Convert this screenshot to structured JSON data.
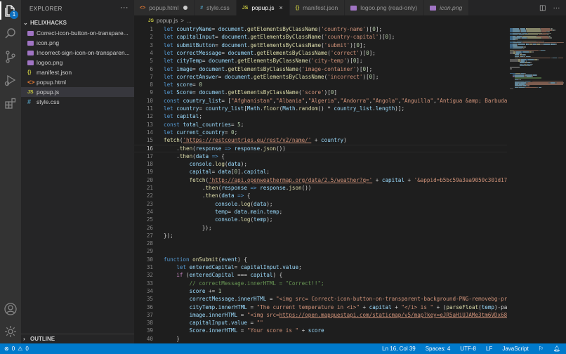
{
  "sidebar": {
    "title": "EXPLORER",
    "folder": "HELIXHACKS",
    "files": [
      {
        "name": "Correct-icon-button-on-transpare...",
        "kind": "image"
      },
      {
        "name": "icon.png",
        "kind": "image"
      },
      {
        "name": "Incorrect-sign-icon-on-transparen...",
        "kind": "image"
      },
      {
        "name": "logoo.png",
        "kind": "image"
      },
      {
        "name": "manifest.json",
        "kind": "json",
        "icon": "{}"
      },
      {
        "name": "popup.html",
        "kind": "html",
        "icon": "<>"
      },
      {
        "name": "popup.js",
        "kind": "js",
        "icon": "JS"
      },
      {
        "name": "style.css",
        "kind": "css",
        "icon": "#"
      }
    ],
    "outline": "OUTLINE"
  },
  "tabs": [
    {
      "label": "popup.html",
      "icon": "<>",
      "state": "modified"
    },
    {
      "label": "style.css",
      "icon": "#",
      "state": "normal"
    },
    {
      "label": "popup.js",
      "icon": "JS",
      "state": "active"
    },
    {
      "label": "manifest.json",
      "icon": "{}",
      "state": "normal"
    },
    {
      "label": "logoo.png (read-only)",
      "icon": "img",
      "state": "normal"
    },
    {
      "label": "icon.png",
      "icon": "img",
      "state": "italic"
    }
  ],
  "breadcrumb": {
    "file_icon": "JS",
    "file": "popup.js",
    "sep": ">",
    "rest": "..."
  },
  "editor": {
    "current_line": 16,
    "lines": [
      [
        [
          "kw",
          "let "
        ],
        [
          "var",
          "countryName"
        ],
        [
          "",
          "= "
        ],
        [
          "var",
          "document"
        ],
        [
          "",
          "."
        ],
        [
          "fn",
          "getElementsByClassName"
        ],
        [
          "",
          "("
        ],
        [
          "str",
          "'country-name'"
        ],
        [
          "",
          ")["
        ],
        [
          "num",
          "0"
        ],
        [
          "",
          "];"
        ]
      ],
      [
        [
          "kw",
          "let "
        ],
        [
          "var",
          "capitalInput"
        ],
        [
          "",
          "= "
        ],
        [
          "var",
          "document"
        ],
        [
          "",
          "."
        ],
        [
          "fn",
          "getElementsByClassName"
        ],
        [
          "",
          "("
        ],
        [
          "str",
          "'country-capital'"
        ],
        [
          "",
          ")["
        ],
        [
          "num",
          "0"
        ],
        [
          "",
          "];"
        ]
      ],
      [
        [
          "kw",
          "let "
        ],
        [
          "var",
          "submitButton"
        ],
        [
          "",
          "= "
        ],
        [
          "var",
          "document"
        ],
        [
          "",
          "."
        ],
        [
          "fn",
          "getElementsByClassName"
        ],
        [
          "",
          "("
        ],
        [
          "str",
          "'submit'"
        ],
        [
          "",
          ")["
        ],
        [
          "num",
          "0"
        ],
        [
          "",
          "];"
        ]
      ],
      [
        [
          "kw",
          "let "
        ],
        [
          "var",
          "correctMessage"
        ],
        [
          "",
          "= "
        ],
        [
          "var",
          "document"
        ],
        [
          "",
          "."
        ],
        [
          "fn",
          "getElementsByClassName"
        ],
        [
          "",
          "("
        ],
        [
          "str",
          "'correct'"
        ],
        [
          "",
          ")["
        ],
        [
          "num",
          "0"
        ],
        [
          "",
          "];"
        ]
      ],
      [
        [
          "kw",
          "let "
        ],
        [
          "var",
          "cityTemp"
        ],
        [
          "",
          "= "
        ],
        [
          "var",
          "document"
        ],
        [
          "",
          "."
        ],
        [
          "fn",
          "getElementsByClassName"
        ],
        [
          "",
          "("
        ],
        [
          "str",
          "'city-temp'"
        ],
        [
          "",
          ")["
        ],
        [
          "num",
          "0"
        ],
        [
          "",
          "];"
        ]
      ],
      [
        [
          "kw",
          "let "
        ],
        [
          "var",
          "image"
        ],
        [
          "",
          "= "
        ],
        [
          "var",
          "document"
        ],
        [
          "",
          "."
        ],
        [
          "fn",
          "getElementsByClassName"
        ],
        [
          "",
          "("
        ],
        [
          "str",
          "'image-container'"
        ],
        [
          "",
          ")["
        ],
        [
          "num",
          "0"
        ],
        [
          "",
          "];"
        ]
      ],
      [
        [
          "kw",
          "let "
        ],
        [
          "var",
          "correctAnswer"
        ],
        [
          "",
          "= "
        ],
        [
          "var",
          "document"
        ],
        [
          "",
          "."
        ],
        [
          "fn",
          "getElementsByClassName"
        ],
        [
          "",
          "("
        ],
        [
          "str",
          "'incorrect'"
        ],
        [
          "",
          ")["
        ],
        [
          "num",
          "0"
        ],
        [
          "",
          "];"
        ]
      ],
      [
        [
          "kw",
          "let "
        ],
        [
          "var",
          "score"
        ],
        [
          "",
          "= "
        ],
        [
          "num",
          "0"
        ]
      ],
      [
        [
          "kw",
          "let "
        ],
        [
          "var",
          "Score"
        ],
        [
          "",
          "= "
        ],
        [
          "var",
          "document"
        ],
        [
          "",
          "."
        ],
        [
          "fn",
          "getElementsByClassName"
        ],
        [
          "",
          "("
        ],
        [
          "str",
          "'score'"
        ],
        [
          "",
          ")["
        ],
        [
          "num",
          "0"
        ],
        [
          "",
          "]"
        ]
      ],
      [
        [
          "kw",
          "const "
        ],
        [
          "var",
          "country_list"
        ],
        [
          "",
          "= ["
        ],
        [
          "str",
          "\"Afghanistan\""
        ],
        [
          "",
          ","
        ],
        [
          "str",
          "\"Albania\""
        ],
        [
          "",
          ","
        ],
        [
          "str",
          "\"Algeria\""
        ],
        [
          "",
          ","
        ],
        [
          "str",
          "\"Andorra\""
        ],
        [
          "",
          ","
        ],
        [
          "str",
          "\"Angola\""
        ],
        [
          "",
          ","
        ],
        [
          "str",
          "\"Anguilla\""
        ],
        [
          "",
          ","
        ],
        [
          "str",
          "\"Antigua &amp; Barbuda\""
        ]
      ],
      [
        [
          "kw",
          "let "
        ],
        [
          "var",
          "country"
        ],
        [
          "",
          "= "
        ],
        [
          "var",
          "country_list"
        ],
        [
          "",
          "["
        ],
        [
          "var",
          "Math"
        ],
        [
          "",
          "."
        ],
        [
          "fn",
          "floor"
        ],
        [
          "",
          "("
        ],
        [
          "var",
          "Math"
        ],
        [
          "",
          "."
        ],
        [
          "fn",
          "random"
        ],
        [
          "",
          "() * "
        ],
        [
          "var",
          "country_list"
        ],
        [
          "",
          "."
        ],
        [
          "var",
          "length"
        ],
        [
          "",
          ")];"
        ]
      ],
      [
        [
          "kw",
          "let "
        ],
        [
          "var",
          "capital"
        ],
        [
          "",
          ";"
        ]
      ],
      [
        [
          "kw",
          "const "
        ],
        [
          "var",
          "total_countries"
        ],
        [
          "",
          "= "
        ],
        [
          "num",
          "5"
        ],
        [
          "",
          ";"
        ]
      ],
      [
        [
          "kw",
          "let "
        ],
        [
          "var",
          "current_country"
        ],
        [
          "",
          "= "
        ],
        [
          "num",
          "0"
        ],
        [
          "",
          ";"
        ]
      ],
      [
        [
          "fn",
          "fetch"
        ],
        [
          "",
          "("
        ],
        [
          "url",
          "'https://restcountries.eu/rest/v2/name/'"
        ],
        [
          "",
          ""
        ],
        [
          "str",
          " "
        ],
        [
          "",
          "+ "
        ],
        [
          "var",
          "country"
        ],
        [
          "",
          ")"
        ]
      ],
      [
        [
          "",
          "    ."
        ],
        [
          "fn",
          "then"
        ],
        [
          "",
          "("
        ],
        [
          "var",
          "response"
        ],
        [
          "",
          ""
        ],
        [
          "kw",
          " =>"
        ],
        [
          "",
          ""
        ],
        [
          "var",
          " response"
        ],
        [
          "",
          "."
        ],
        [
          "fn",
          "json"
        ],
        [
          "",
          "())"
        ]
      ],
      [
        [
          "",
          "    ."
        ],
        [
          "fn",
          "then"
        ],
        [
          "",
          "("
        ],
        [
          "var",
          "data"
        ],
        [
          "kw",
          " =>"
        ],
        [
          "",
          ""
        ],
        [
          "",
          ""
        ],
        [
          "",
          ""
        ],
        [
          "",
          ""
        ],
        [
          "",
          ""
        ],
        [
          "",
          ""
        ],
        [
          "",
          " {"
        ]
      ],
      [
        [
          "",
          "        "
        ],
        [
          "var",
          "console"
        ],
        [
          "",
          "."
        ],
        [
          "fn",
          "log"
        ],
        [
          "",
          "("
        ],
        [
          "var",
          "data"
        ],
        [
          "",
          ");"
        ]
      ],
      [
        [
          "",
          "        "
        ],
        [
          "var",
          "capital"
        ],
        [
          "",
          "= "
        ],
        [
          "var",
          "data"
        ],
        [
          "",
          "["
        ],
        [
          "num",
          "0"
        ],
        [
          "",
          "]."
        ],
        [
          "var",
          "capital"
        ],
        [
          "",
          ";"
        ]
      ],
      [
        [
          "",
          "        "
        ],
        [
          "fn",
          "fetch"
        ],
        [
          "",
          "("
        ],
        [
          "url",
          "'http://api.openweathermap.org/data/2.5/weather?q='"
        ],
        [
          "",
          " + "
        ],
        [
          "var",
          "capital"
        ],
        [
          "",
          " + "
        ],
        [
          "str",
          "'&appid=b5bc59a3aa9050c301d170"
        ]
      ],
      [
        [
          "",
          "            ."
        ],
        [
          "fn",
          "then"
        ],
        [
          "",
          "("
        ],
        [
          "var",
          "response"
        ],
        [
          "kw",
          " =>"
        ],
        [
          "var",
          " response"
        ],
        [
          "",
          "."
        ],
        [
          "fn",
          "json"
        ],
        [
          "",
          "())"
        ]
      ],
      [
        [
          "",
          "            ."
        ],
        [
          "fn",
          "then"
        ],
        [
          "",
          "("
        ],
        [
          "var",
          "data"
        ],
        [
          "kw",
          " =>"
        ],
        [
          "",
          " {"
        ]
      ],
      [
        [
          "",
          "                "
        ],
        [
          "var",
          "console"
        ],
        [
          "",
          "."
        ],
        [
          "fn",
          "log"
        ],
        [
          "",
          "("
        ],
        [
          "var",
          "data"
        ],
        [
          "",
          ");"
        ]
      ],
      [
        [
          "",
          "                "
        ],
        [
          "var",
          "temp"
        ],
        [
          "",
          "= "
        ],
        [
          "var",
          "data"
        ],
        [
          "",
          "."
        ],
        [
          "var",
          "main"
        ],
        [
          "",
          "."
        ],
        [
          "var",
          "temp"
        ],
        [
          "",
          ";"
        ]
      ],
      [
        [
          "",
          "                "
        ],
        [
          "var",
          "console"
        ],
        [
          "",
          "."
        ],
        [
          "fn",
          "log"
        ],
        [
          "",
          "("
        ],
        [
          "var",
          "temp"
        ],
        [
          "",
          ");"
        ]
      ],
      [
        [
          "",
          "            });"
        ]
      ],
      [
        [
          "",
          "});"
        ]
      ],
      [],
      [],
      [
        [
          "kw",
          "function "
        ],
        [
          "fn",
          "onSubmit"
        ],
        [
          "",
          "("
        ],
        [
          "var",
          "event"
        ],
        [
          "",
          ") {"
        ]
      ],
      [
        [
          "",
          "    "
        ],
        [
          "kw",
          "let "
        ],
        [
          "var",
          "enteredCapital"
        ],
        [
          "",
          "= "
        ],
        [
          "var",
          "capitalInput"
        ],
        [
          "",
          "."
        ],
        [
          "var",
          "value"
        ],
        [
          "",
          ";"
        ]
      ],
      [
        [
          "",
          "    "
        ],
        [
          "ctl",
          "if "
        ],
        [
          "",
          "("
        ],
        [
          "var",
          "enteredCapital"
        ],
        [
          "",
          " === "
        ],
        [
          "var",
          "capital"
        ],
        [
          "",
          ") {"
        ]
      ],
      [
        [
          "",
          "        "
        ],
        [
          "cmt",
          "// correctMessage.innerHTML = \"Correct!!\";"
        ]
      ],
      [
        [
          "",
          "        "
        ],
        [
          "var",
          "score"
        ],
        [
          "",
          " += "
        ],
        [
          "num",
          "1"
        ]
      ],
      [
        [
          "",
          "        "
        ],
        [
          "var",
          "correctMessage"
        ],
        [
          "",
          "."
        ],
        [
          "var",
          "innerHTML"
        ],
        [
          "",
          " = "
        ],
        [
          "str",
          "\"<img src= Correct-icon-button-on-transparent-background-PNG-removebg-pre"
        ]
      ],
      [
        [
          "",
          "        "
        ],
        [
          "var",
          "cityTemp"
        ],
        [
          "",
          "."
        ],
        [
          "var",
          "innerHTML"
        ],
        [
          "",
          " = "
        ],
        [
          "str",
          "\"The current temperature in <i>\""
        ],
        [
          "",
          " + "
        ],
        [
          "var",
          "capital"
        ],
        [
          "",
          " + "
        ],
        [
          "str",
          "\"</i> is \""
        ],
        [
          "",
          " + ("
        ],
        [
          "fn",
          "parseFloat"
        ],
        [
          "",
          "("
        ],
        [
          "var",
          "temp"
        ],
        [
          "",
          ")-par"
        ]
      ],
      [
        [
          "",
          "        "
        ],
        [
          "var",
          "image"
        ],
        [
          "",
          "."
        ],
        [
          "var",
          "innerHTML"
        ],
        [
          "",
          " = "
        ],
        [
          "str",
          "\"<img src="
        ],
        [
          "url",
          "https://open.mapquestapi.com/staticmap/v5/map?key=eJR5aHiUJAMe3tm6VDx68h"
        ]
      ],
      [
        [
          "",
          "        "
        ],
        [
          "var",
          "capitalInput"
        ],
        [
          "",
          "."
        ],
        [
          "var",
          "value"
        ],
        [
          "",
          " = "
        ],
        [
          "str",
          "\"\""
        ]
      ],
      [
        [
          "",
          "        "
        ],
        [
          "var",
          "Score"
        ],
        [
          "",
          "."
        ],
        [
          "var",
          "innerHTML"
        ],
        [
          "",
          " = "
        ],
        [
          "str",
          "\"Your score is \""
        ],
        [
          "",
          " + "
        ],
        [
          "var",
          "score"
        ]
      ],
      [
        [
          "",
          "    }"
        ]
      ]
    ]
  },
  "status": {
    "errors": "0",
    "warnings": "0",
    "cursor": "Ln 16, Col 39",
    "spaces": "Spaces: 4",
    "encoding": "UTF-8",
    "eol": "LF",
    "language": "JavaScript"
  },
  "colors": {
    "accent": "#007acc",
    "badge": "#0e70c0",
    "editor_bg": "#1e1e1e",
    "sidebar_bg": "#252526"
  },
  "activity_icons": [
    "files-icon",
    "search-icon",
    "source-control-icon",
    "run-debug-icon",
    "extensions-icon",
    "account-icon",
    "settings-gear-icon"
  ],
  "badge_count": "1"
}
